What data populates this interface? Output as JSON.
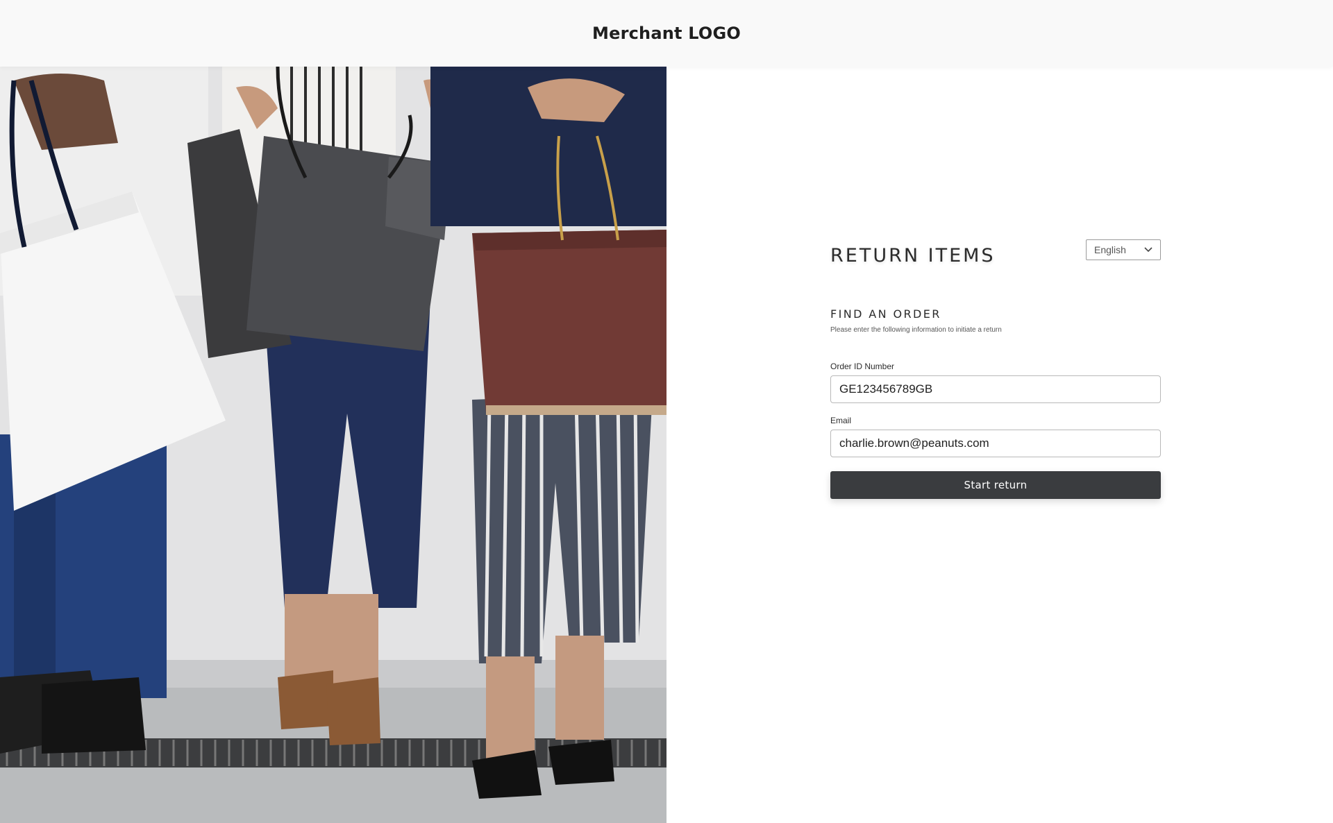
{
  "header": {
    "logo_text": "Merchant LOGO"
  },
  "hero": {
    "image_subject": "shoppers-holding-bags"
  },
  "form": {
    "title": "RETURN ITEMS",
    "language": {
      "selected": "English"
    },
    "section_title": "FIND AN ORDER",
    "section_subtitle": "Please enter the following information to initiate a return",
    "order_id": {
      "label": "Order ID Number",
      "value": "GE123456789GB"
    },
    "email": {
      "label": "Email",
      "value": "charlie.brown@peanuts.com"
    },
    "submit_label": "Start return"
  },
  "colors": {
    "button_bg": "#3a3c3f",
    "header_bg": "#f9f9f9",
    "input_border": "#b8b8b8"
  }
}
